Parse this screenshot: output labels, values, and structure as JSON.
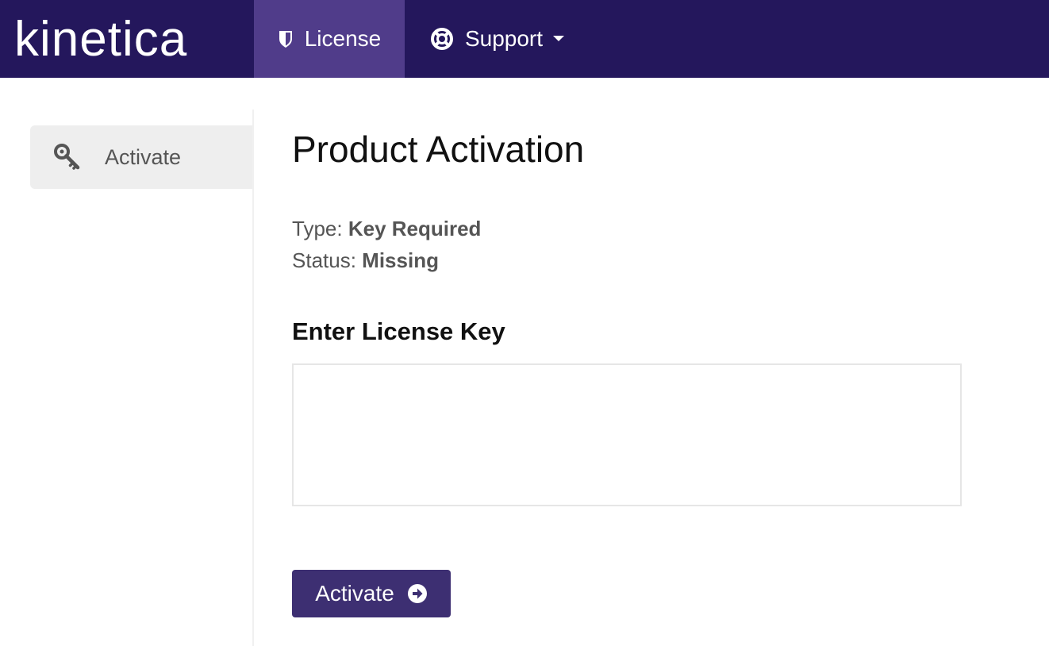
{
  "header": {
    "logo_text": "kinetica",
    "nav": {
      "license": {
        "label": "License",
        "icon": "shield-icon"
      },
      "support": {
        "label": "Support",
        "icon": "life-ring-icon",
        "caret": "chevron-down-icon"
      }
    },
    "colors": {
      "bar": "#24175c",
      "active_tab": "#503c8a"
    }
  },
  "sidebar": {
    "items": [
      {
        "label": "Activate",
        "icon": "key-icon",
        "active": true
      }
    ]
  },
  "main": {
    "title": "Product Activation",
    "type_label": "Type:",
    "type_value": "Key Required",
    "status_label": "Status:",
    "status_value": "Missing",
    "section_heading": "Enter License Key",
    "license_key_value": "",
    "activate_button": {
      "label": "Activate",
      "icon": "arrow-circle-right-icon",
      "color": "#3d2f72"
    }
  }
}
